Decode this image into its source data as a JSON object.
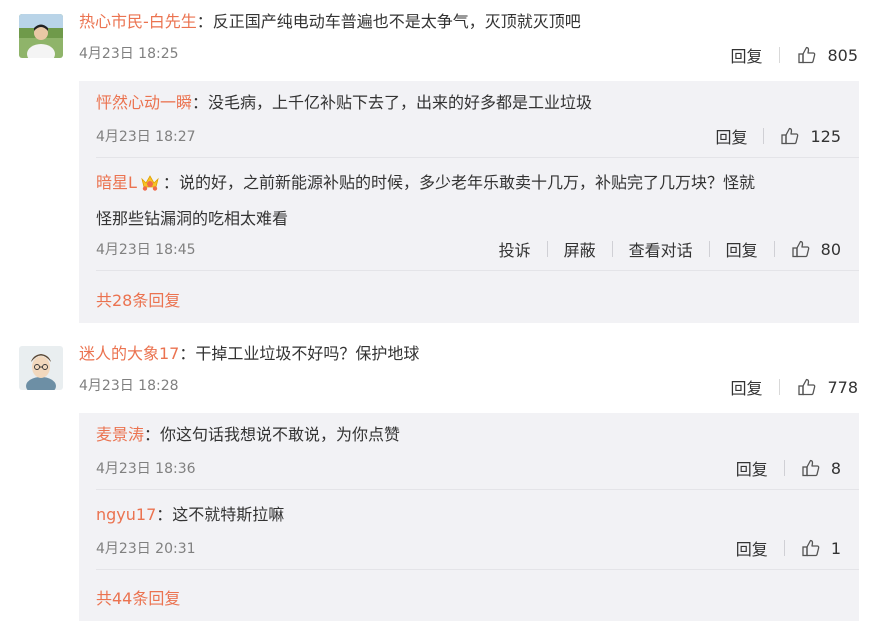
{
  "comments": [
    {
      "username": "热心市民-白先生",
      "sep": "：",
      "text": "反正国产纯电动车普遍也不是太争气，灭顶就灭顶吧",
      "time": "4月23日 18:25",
      "reply_label": "回复",
      "likes": "805",
      "replies": [
        {
          "username": "怦然心动一瞬",
          "sep": "：",
          "text": "没毛病，上千亿补贴下去了，出来的好多都是工业垃圾",
          "time": "4月23日 18:27",
          "reply_label": "回复",
          "likes": "125"
        },
        {
          "username": "暗星L",
          "badge_icon": "crown-emoji-icon",
          "sep": "：",
          "text_line1": "说的好，之前新能源补贴的时候，多少老年乐敢卖十几万，补贴完了几万块？怪就",
          "text_line2": "怪那些钻漏洞的吃相太难看",
          "time": "4月23日 18:45",
          "report_label": "投诉",
          "block_label": "屏蔽",
          "view_conv_label": "查看对话",
          "reply_label": "回复",
          "likes": "80"
        }
      ],
      "more_label": "共28条回复"
    },
    {
      "username": "迷人的大象17",
      "sep": "：",
      "text": "干掉工业垃圾不好吗？保护地球",
      "time": "4月23日 18:28",
      "reply_label": "回复",
      "likes": "778",
      "replies": [
        {
          "username": "麦景涛",
          "sep": "：",
          "text": "你这句话我想说不敢说，为你点赞",
          "time": "4月23日 18:36",
          "reply_label": "回复",
          "likes": "8"
        },
        {
          "username": "ngyu17",
          "sep": "：",
          "text": "这不就特斯拉嘛",
          "time": "4月23日 20:31",
          "reply_label": "回复",
          "likes": "1"
        }
      ],
      "more_label": "共44条回复"
    }
  ],
  "colors": {
    "username": "#eb7350",
    "reply_bg": "#f2f2f5",
    "time": "#808080"
  }
}
